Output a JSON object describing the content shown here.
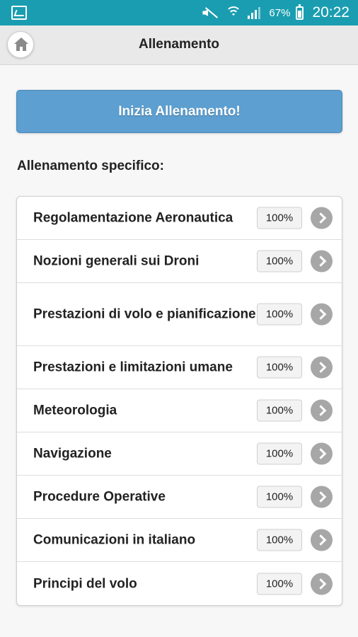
{
  "status_bar": {
    "battery": "67%",
    "time": "20:22"
  },
  "header": {
    "title": "Allenamento",
    "home_icon": "home-icon"
  },
  "start_button": {
    "label": "Inizia Allenamento!"
  },
  "section": {
    "label": "Allenamento specifico:"
  },
  "topics": [
    {
      "label": "Regolamentazione Aeronautica",
      "count": "100%"
    },
    {
      "label": "Nozioni generali sui Droni",
      "count": "100%"
    },
    {
      "label": "Prestazioni di volo e pianificazione",
      "count": "100%"
    },
    {
      "label": "Prestazioni e limitazioni umane",
      "count": "100%"
    },
    {
      "label": "Meteorologia",
      "count": "100%"
    },
    {
      "label": "Navigazione",
      "count": "100%"
    },
    {
      "label": "Procedure Operative",
      "count": "100%"
    },
    {
      "label": "Comunicazioni in italiano",
      "count": "100%"
    },
    {
      "label": "Principi del volo",
      "count": "100%"
    }
  ],
  "colors": {
    "status_bar": "#1a9db0",
    "primary_button": "#5c9fd0",
    "arrow": "#a7a7a7"
  }
}
